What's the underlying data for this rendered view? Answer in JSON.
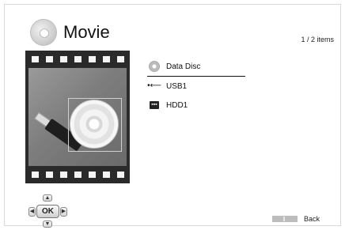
{
  "header": {
    "title": "Movie",
    "count": "1 / 2 items"
  },
  "menu": {
    "items": [
      {
        "label": "Data Disc",
        "icon": "disc-icon",
        "selected": true
      },
      {
        "label": "USB1",
        "icon": "usb-icon",
        "selected": false
      },
      {
        "label": "HDD1",
        "icon": "hdd-icon",
        "selected": false
      }
    ]
  },
  "nav": {
    "ok_label": "OK",
    "up": "▲",
    "down": "▼",
    "left": "◀",
    "right": "▶"
  },
  "footer": {
    "back_label": "Back"
  }
}
